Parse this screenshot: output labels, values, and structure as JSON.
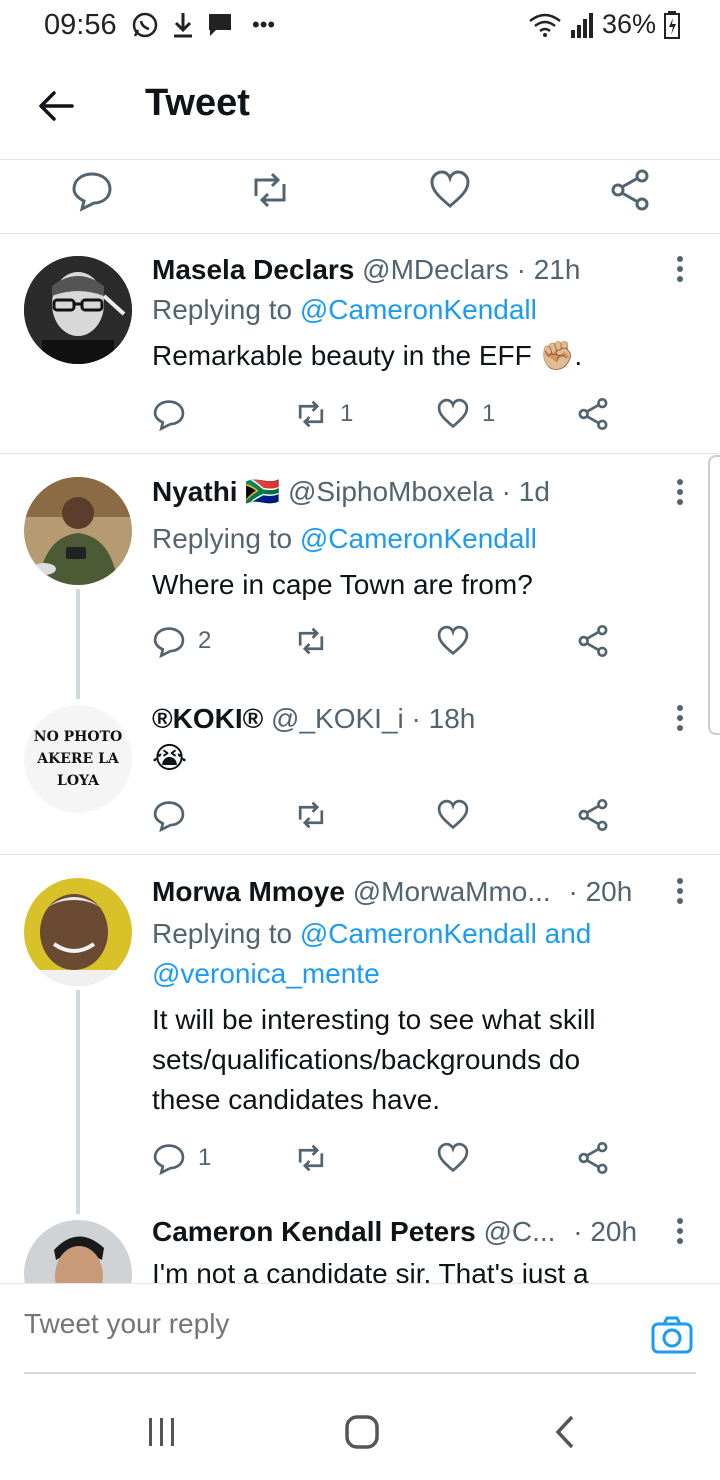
{
  "status": {
    "time": "09:56",
    "battery": "36%"
  },
  "header": {
    "title": "Tweet"
  },
  "tweets": [
    {
      "name": "Masela Declars",
      "handle": "@MDeclars",
      "time": "· 21h",
      "replying_prefix": "Replying to ",
      "replying_to": "@CameronKendall",
      "text": "Remarkable beauty in the EFF ✊🏼.",
      "reply_count": "",
      "retweet_count": "1",
      "like_count": "1"
    },
    {
      "name": "Nyathi 🇿🇦",
      "handle": "@SiphoMboxela",
      "time": "· 1d",
      "replying_prefix": "Replying to ",
      "replying_to": "@CameronKendall",
      "text": "Where in cape Town are from?",
      "reply_count": "2",
      "retweet_count": "",
      "like_count": ""
    },
    {
      "name": "®KOKI®",
      "handle": "@_KOKI_i",
      "time": "· 18h",
      "avatar_text": "NO PHOTO AKERE LA LOYA",
      "text": "😭",
      "reply_count": "",
      "retweet_count": "",
      "like_count": ""
    },
    {
      "name": "Morwa Mmoye",
      "handle": "@MorwaMmo...",
      "time": "· 20h",
      "replying_prefix": "Replying to ",
      "replying_to": "@CameronKendall and",
      "replying_to_2": "@veronica_mente",
      "text_lines": [
        "It will be interesting to see what skill",
        "sets/qualifications/backgrounds do",
        "these candidates have."
      ],
      "reply_count": "1",
      "retweet_count": "",
      "like_count": ""
    },
    {
      "name": "Cameron Kendall Peters",
      "handle": "@C...",
      "time": "· 20h",
      "text": "I'm not a candidate sir. That's just a"
    }
  ],
  "compose": {
    "placeholder": "Tweet your reply"
  },
  "colors": {
    "accent": "#1d9bf0",
    "muted": "#536471",
    "text": "#0f1419"
  }
}
